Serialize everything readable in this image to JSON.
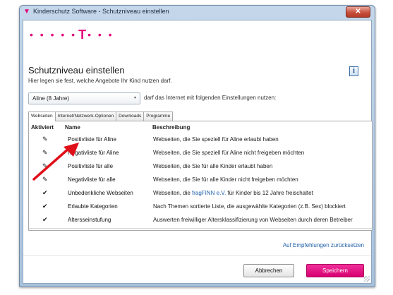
{
  "window": {
    "title": "Kinderschutz Software - Schutzniveau einstellen",
    "close_label": "✕"
  },
  "logo": {
    "dots_left": "• • • • •",
    "letter": "T",
    "dots_right": "• • •"
  },
  "header": {
    "title": "Schutzniveau einstellen",
    "subtitle": "Hier legen sie fest, welche Angebote Ihr Kind nutzen darf.",
    "info_label": "i"
  },
  "profile": {
    "selected": "Aline (8 Jahre)",
    "arrow": "▾",
    "description": "darf das Internet mit folgenden Einstellungen nutzen:"
  },
  "tabs": [
    "Webseiten",
    "Internet/Netzwerk-Optionen",
    "Downloads",
    "Programme"
  ],
  "table": {
    "headers": {
      "active": "Aktiviert",
      "name": "Name",
      "description": "Beschreibung"
    },
    "rows": [
      {
        "mark": "✎",
        "name": "Positivliste für Aline",
        "desc_pre": "Webseiten, die Sie speziell für Aline erlaubt haben",
        "link": "",
        "desc_post": ""
      },
      {
        "mark": "✎",
        "name": "Negativliste für Aline",
        "desc_pre": "Webseiten, die Sie speziell für Aline nicht freigeben möchten",
        "link": "",
        "desc_post": ""
      },
      {
        "mark": "✎",
        "name": "Positivliste für alle",
        "desc_pre": "Webseiten, die Sie für alle Kinder erlaubt haben",
        "link": "",
        "desc_post": ""
      },
      {
        "mark": "✎",
        "name": "Negativliste für alle",
        "desc_pre": "Webseiten, die Sie für alle Kinder nicht freigeben möchten",
        "link": "",
        "desc_post": ""
      },
      {
        "mark": "✔",
        "name": "Unbedenkliche Webseiten",
        "desc_pre": "Webseiten, die ",
        "link": "fragFINN e.V.",
        "desc_post": " für Kinder bis 12 Jahre freischaltet"
      },
      {
        "mark": "✔",
        "name": "Erlaubte Kategorien",
        "desc_pre": "Nach Themen sortierte Liste, die ausgewählte Kategorien (z.B. Sex) blockiert",
        "link": "",
        "desc_post": ""
      },
      {
        "mark": "✔",
        "name": "Altersseinstufung",
        "desc_pre": "Auswerten freiwilliger Altersklassifizierung von Webseiten durch deren Betreiber",
        "link": "",
        "desc_post": ""
      }
    ]
  },
  "restore_link": "Auf Empfehlungen zurücksetzen",
  "buttons": {
    "cancel": "Abbrechen",
    "save": "Speichern"
  },
  "colors": {
    "brand": "#e2007a",
    "link": "#1f5fa8",
    "annotation_arrow": "#e0101a"
  }
}
